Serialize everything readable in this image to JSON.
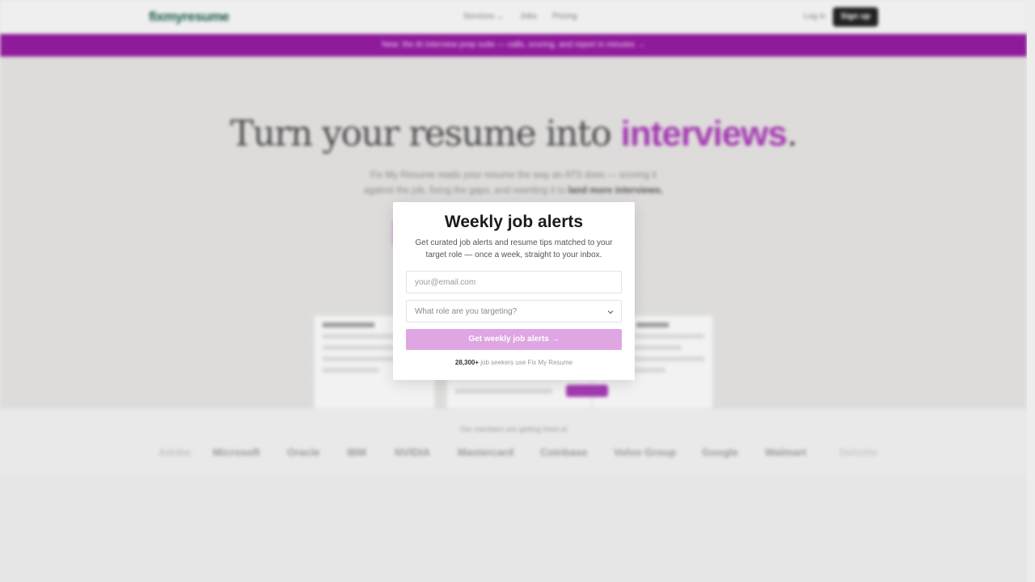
{
  "nav": {
    "logo": "fixmyresume",
    "links": [
      "Services ⌄",
      "Jobs",
      "Pricing"
    ],
    "login": "Log in",
    "signup": "Sign up"
  },
  "banner": {
    "text": "New: the AI interview prep suite — calls, scoring, and report in minutes →"
  },
  "hero": {
    "title_main": "Turn your resume into ",
    "title_accent": "interviews",
    "title_end": ".",
    "subtitle_line1": "Fix My Resume reads your resume the way an ATS does — scoring it",
    "subtitle_line2": "against the job, fixing the gaps, and rewriting it to ",
    "subtitle_bold": "land more interviews."
  },
  "logos": {
    "caption": "Our members are getting hired at",
    "companies": [
      "Adobe",
      "Microsoft",
      "Oracle",
      "IBM",
      "NVIDIA",
      "Mastercard",
      "Coinbase",
      "Volvo Group",
      "Google",
      "Walmart",
      "Deloitte"
    ]
  },
  "modal": {
    "title": "Weekly job alerts",
    "description": "Get curated job alerts and resume tips matched to your target role — once a week, straight to your inbox.",
    "email_placeholder": "your@email.com",
    "role_placeholder": "What role are you targeting?",
    "submit_label": "Get weekly job alerts →",
    "proof_count": "28,300+",
    "proof_text": " job seekers use Fix My Resume"
  },
  "colors": {
    "brand_purple": "#8f1a9a",
    "accent_purple": "#a33ab0",
    "button_disabled": "#dea6e2",
    "logo_green": "#1d5a50"
  }
}
